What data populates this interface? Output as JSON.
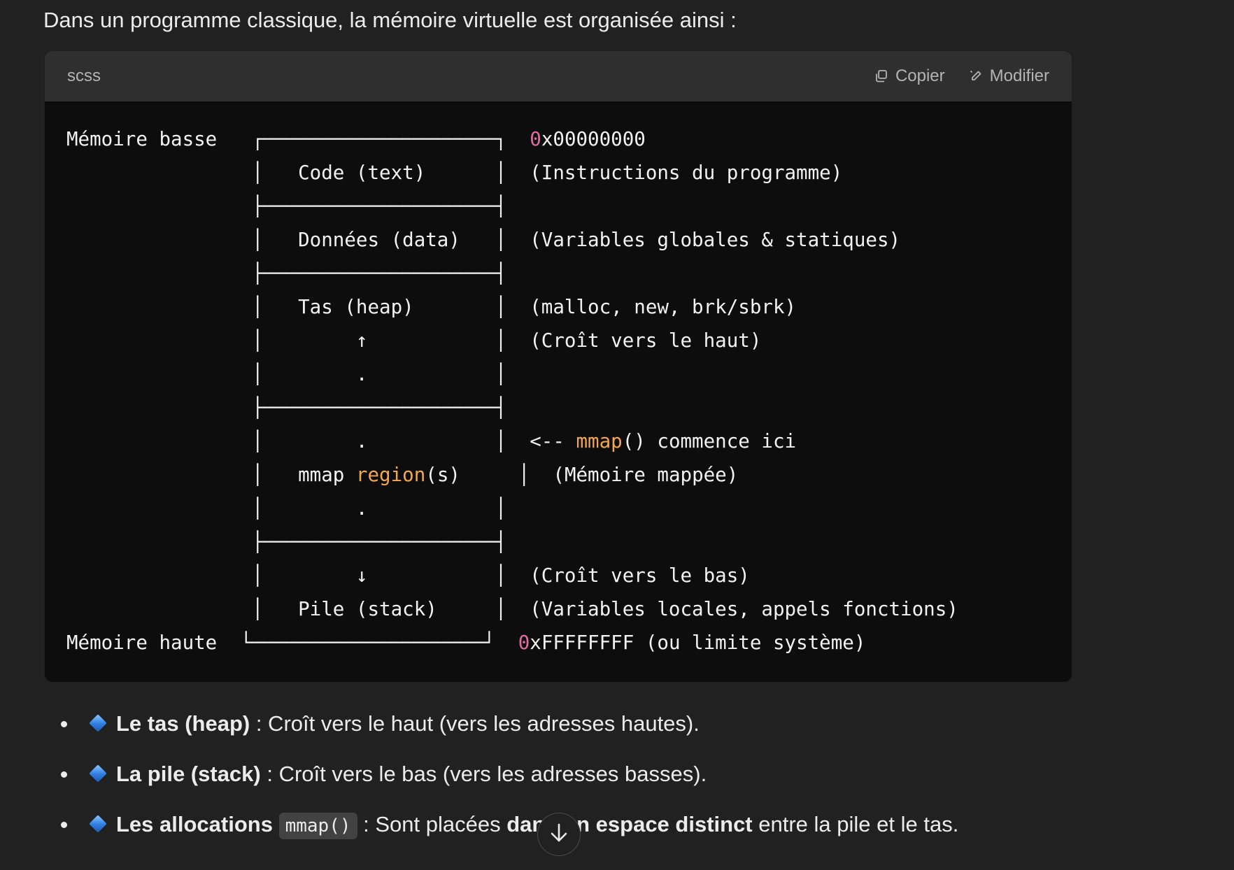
{
  "intro": "Dans un programme classique, la mémoire virtuelle est organisée ainsi :",
  "code": {
    "language": "scss",
    "copy_label": "Copier",
    "edit_label": "Modifier",
    "lines": [
      [
        {
          "t": "Mémoire basse   ┌────────────────────┐  "
        },
        {
          "t": "0",
          "c": "num"
        },
        {
          "t": "x00000000"
        }
      ],
      [
        {
          "t": "                │   Code (text)      │  (Instructions du programme)"
        }
      ],
      [
        {
          "t": "                ├────────────────────┤"
        }
      ],
      [
        {
          "t": "                │   Données (data)   │  (Variables globales & statiques)"
        }
      ],
      [
        {
          "t": "                ├────────────────────┤"
        }
      ],
      [
        {
          "t": "                │   Tas (heap)       │  (malloc, new, brk/sbrk)"
        }
      ],
      [
        {
          "t": "                │        ↑           │  (Croît vers le haut)"
        }
      ],
      [
        {
          "t": "                │        .           │"
        }
      ],
      [
        {
          "t": "                ├────────────────────┤"
        }
      ],
      [
        {
          "t": "                │        .           │  <-- "
        },
        {
          "t": "mmap",
          "c": "fn"
        },
        {
          "t": "() commence ici"
        }
      ],
      [
        {
          "t": "                │   mmap "
        },
        {
          "t": "region",
          "c": "fn"
        },
        {
          "t": "(s)     │  (Mémoire mappée)"
        }
      ],
      [
        {
          "t": "                │        .           │"
        }
      ],
      [
        {
          "t": "                ├────────────────────┤"
        }
      ],
      [
        {
          "t": "                │        ↓           │  (Croît vers le bas)"
        }
      ],
      [
        {
          "t": "                │   Pile (stack)     │  (Variables locales, appels fonctions)"
        }
      ],
      [
        {
          "t": "Mémoire haute  └────────────────────┘  "
        },
        {
          "t": "0",
          "c": "num"
        },
        {
          "t": "xFFFFFFFF (ou limite système)"
        }
      ]
    ]
  },
  "bullets": [
    {
      "bold": "Le tas (heap)",
      "rest": " : Croît vers le haut (vers les adresses hautes)."
    },
    {
      "bold": "La pile (stack)",
      "rest": " : Croît vers le bas (vers les adresses basses)."
    },
    {
      "bold": "Les allocations",
      "code": "mmap()",
      "rest": " : Sont placées ",
      "bold2": "dans un espace distinct",
      "rest2": " entre la pile et le tas."
    }
  ],
  "icons": {
    "copy": "copy-icon",
    "edit": "pencil-icon",
    "bullet": "blue-diamond-icon",
    "scroll": "arrow-down-icon"
  },
  "colors": {
    "accent_number": "#e06c9f",
    "accent_function": "#f4a64b",
    "diamond": "#2f7de0"
  }
}
